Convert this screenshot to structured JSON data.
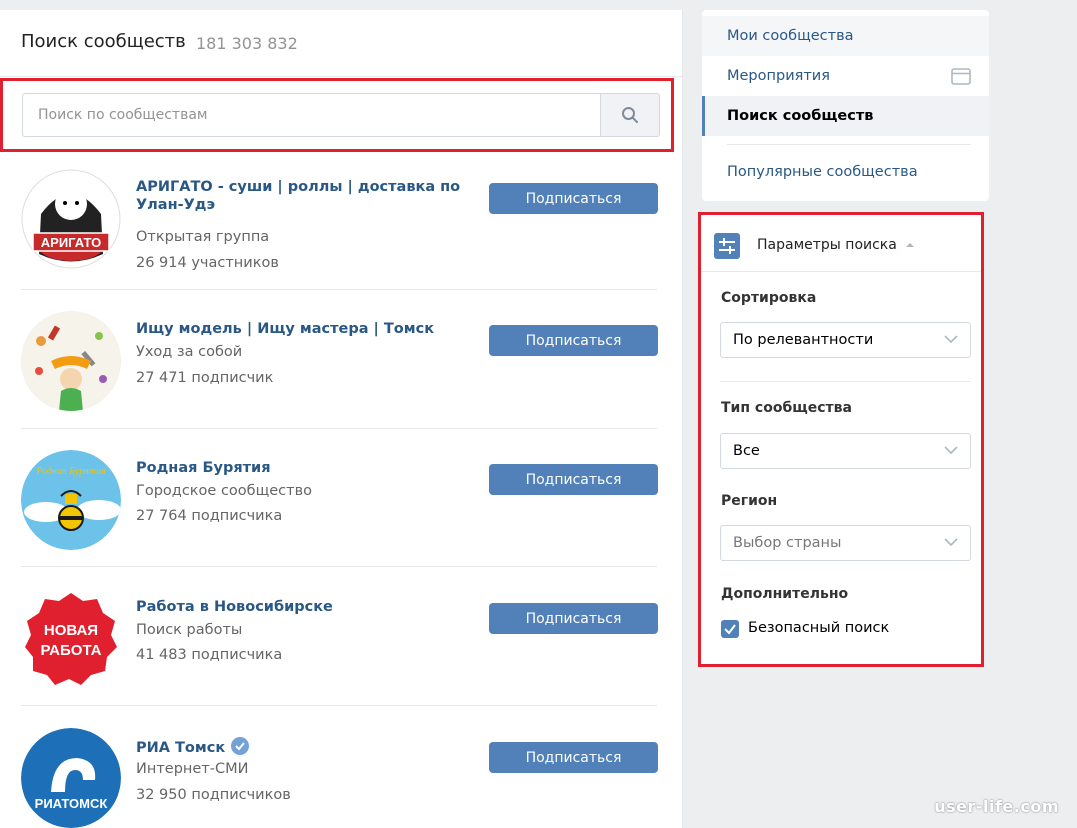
{
  "main": {
    "title": "Поиск сообществ",
    "count": "181 303 832",
    "search_placeholder": "Поиск по сообществам"
  },
  "communities": [
    {
      "name": "АРИГАТО - суши | роллы | доставка по Улан-Удэ",
      "type": "Открытая группа",
      "members": "26 914 участников",
      "button": "Подписаться",
      "avatar_text": "АРИГАТО"
    },
    {
      "name": "Ищу модель | Ищу мастера | Томск",
      "type": "Уход за собой",
      "members": "27 471 подписчик",
      "button": "Подписаться"
    },
    {
      "name": "Родная Бурятия",
      "type": "Городское сообщество",
      "members": "27 764 подписчика",
      "button": "Подписаться",
      "avatar_text": "Родная Бурятия"
    },
    {
      "name": "Работа в Новосибирске",
      "type": "Поиск работы",
      "members": "41 483 подписчика",
      "button": "Подписаться",
      "avatar_text": "НОВАЯ РАБОТА"
    },
    {
      "name": "РИА Томск",
      "type": "Интернет-СМИ",
      "members": "32 950 подписчиков",
      "button": "Подписаться",
      "avatar_text": "РИАТОМСК",
      "verified": true
    }
  ],
  "menu": {
    "items": [
      "Мои сообщества",
      "Мероприятия",
      "Поиск сообществ",
      "Популярные сообщества"
    ]
  },
  "filters": {
    "title": "Параметры поиска",
    "sort_label": "Сортировка",
    "sort_value": "По релевантности",
    "type_label": "Тип сообщества",
    "type_value": "Все",
    "region_label": "Регион",
    "region_placeholder": "Выбор страны",
    "extra_label": "Дополнительно",
    "safe_search_label": "Безопасный поиск",
    "safe_search_checked": true
  },
  "watermark": "user-life.com",
  "colors": {
    "accent": "#5181b8",
    "link": "#2a5885",
    "highlight": "#e0202e"
  }
}
